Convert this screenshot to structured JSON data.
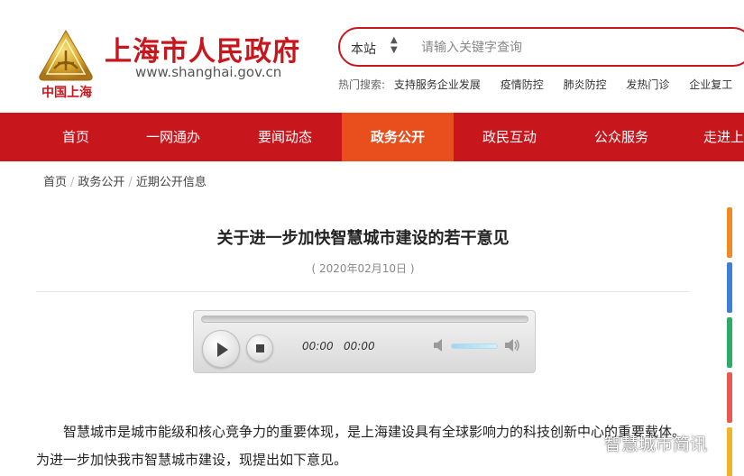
{
  "header": {
    "logo_subtext": "中国上海",
    "site_title": "上海市人民政府",
    "site_url": "www.shanghai.gov.cn",
    "search": {
      "scope": "本站",
      "placeholder": "请输入关键字查询"
    },
    "hot_search": {
      "label": "热门搜索:",
      "items": [
        "支持服务企业发展",
        "疫情防控",
        "肺炎防控",
        "发热门诊",
        "企业复工"
      ]
    }
  },
  "nav": {
    "items": [
      "首页",
      "一网通办",
      "要闻动态",
      "政务公开",
      "政民互动",
      "公众服务",
      "走进上"
    ],
    "active_index": 3
  },
  "breadcrumb": [
    "首页",
    "政务公开",
    "近期公开信息"
  ],
  "article": {
    "title": "关于进一步加快智慧城市建设的若干意见",
    "date": "( 2020年02月10日 )",
    "paragraph": "智慧城市是城市能级和核心竞争力的重要体现，是上海建设具有全球影响力的科技创新中心的重要载体。为进一步加快我市智慧城市建设，现提出如下意见。"
  },
  "audio_player": {
    "current_time": "00:00",
    "duration": "00:00",
    "progress": 0,
    "volume": 0.8
  },
  "side_bars": {
    "colors": [
      "#f08a24",
      "#3f7fd6",
      "#2eaa6b",
      "#e85a4f",
      "#f0b429"
    ]
  },
  "watermark": {
    "text": "智慧城市简讯"
  },
  "colors": {
    "brand_red": "#c8161d",
    "nav_active": "#e84f1c"
  }
}
